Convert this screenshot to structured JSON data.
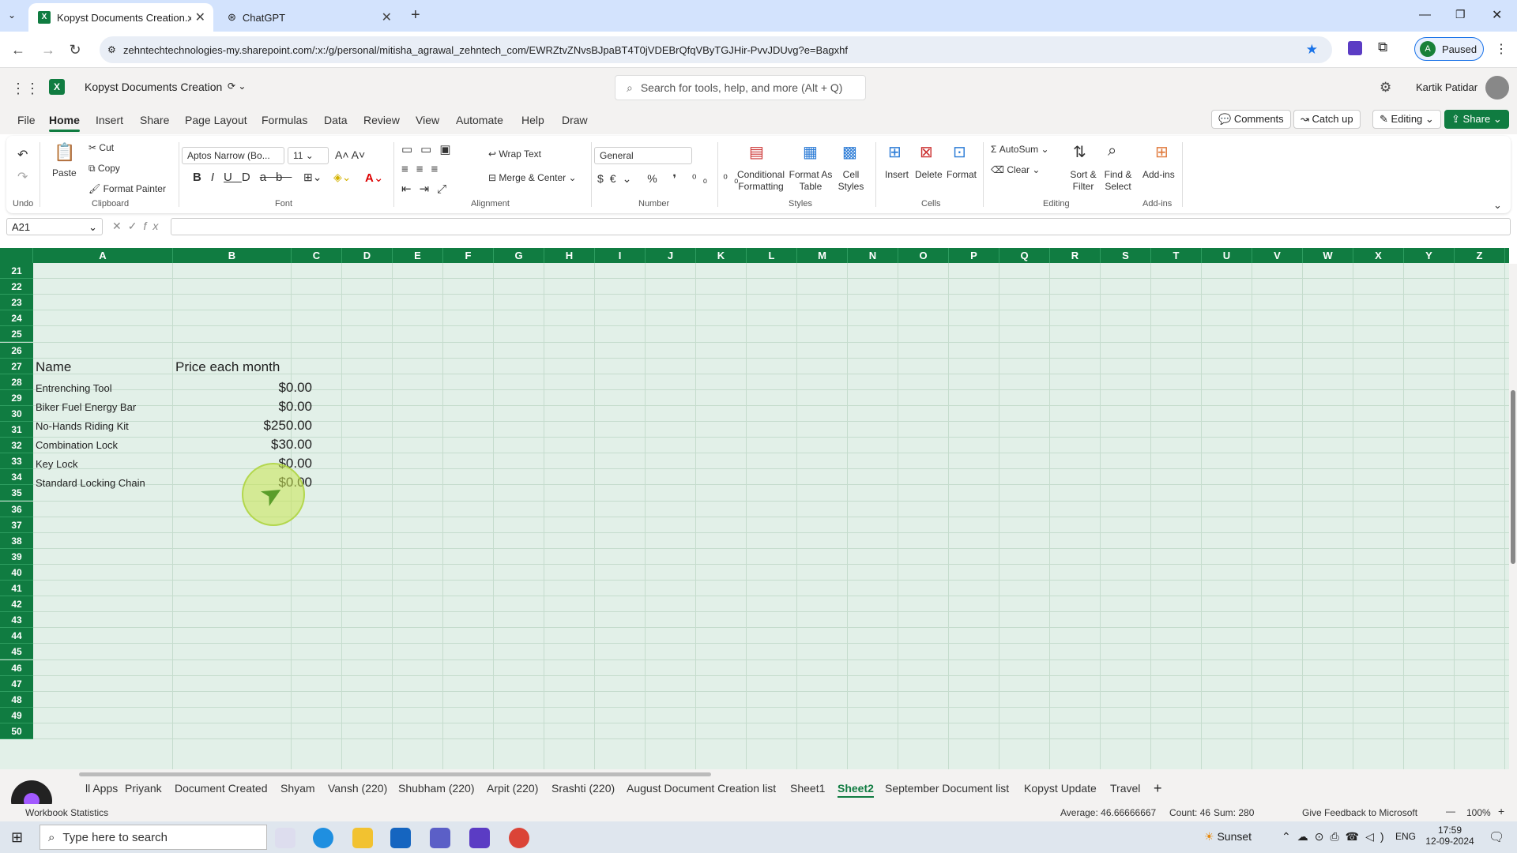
{
  "browser": {
    "tabs": [
      {
        "label": "Kopyst Documents Creation.xls"
      },
      {
        "label": "ChatGPT"
      }
    ],
    "url": "zehntechtechnologies-my.sharepoint.com/:x:/g/personal/mitisha_agrawal_zehntech_com/EWRZtvZNvsBJpaBT4T0jVDEBrQfqVByTGJHir-PvvJDUvg?e=Bagxhf",
    "profile_label": "Paused",
    "profile_initial": "A"
  },
  "excel": {
    "file_name": "Kopyst Documents Creation",
    "search_placeholder": "Search for tools, help, and more (Alt + Q)",
    "user_name": "Kartik Patidar",
    "ribbon_tabs": [
      "File",
      "Home",
      "Insert",
      "Share",
      "Page Layout",
      "Formulas",
      "Data",
      "Review",
      "View",
      "Automate",
      "Help",
      "Draw"
    ],
    "header_buttons": {
      "comments": "Comments",
      "catch_up": "Catch up",
      "editing": "Editing",
      "share": "Share"
    },
    "ribbon": {
      "undo_label": "Undo",
      "paste": "Paste",
      "cut": "Cut",
      "copy": "Copy",
      "format_painter": "Format Painter",
      "clipboard_label": "Clipboard",
      "font_name": "Aptos Narrow (Bo...",
      "font_size": "11",
      "font_label": "Font",
      "wrap_text": "Wrap Text",
      "merge_center": "Merge & Center",
      "alignment_label": "Alignment",
      "number_format": "General",
      "number_label": "Number",
      "conditional_formatting": "Conditional Formatting",
      "format_as_table": "Format As Table",
      "cell_styles": "Cell Styles",
      "styles_label": "Styles",
      "insert": "Insert",
      "delete": "Delete",
      "format": "Format",
      "cells_label": "Cells",
      "autosum": "AutoSum",
      "clear": "Clear",
      "sort_filter": "Sort & Filter",
      "find_select": "Find & Select",
      "editing_label": "Editing",
      "addins": "Add-ins",
      "addins_label": "Add-ins"
    },
    "name_box": "A21",
    "columns": [
      "A",
      "B",
      "C",
      "D",
      "E",
      "F",
      "G",
      "H",
      "I",
      "J",
      "K",
      "L",
      "M",
      "N",
      "O",
      "P",
      "Q",
      "R",
      "S",
      "T",
      "U",
      "V",
      "W",
      "X",
      "Y",
      "Z"
    ],
    "rows": [
      "21",
      "22",
      "23",
      "24",
      "25",
      "26",
      "27",
      "28",
      "29",
      "30",
      "31",
      "32",
      "33",
      "34",
      "35",
      "36",
      "37",
      "38",
      "39",
      "40",
      "41",
      "42",
      "43",
      "44",
      "45",
      "46",
      "47",
      "48",
      "49",
      "50"
    ],
    "table": {
      "header_name": "Name",
      "header_price": "Price each month",
      "items": [
        {
          "name": "Entrenching Tool",
          "price": "$0.00"
        },
        {
          "name": "Biker Fuel Energy Bar",
          "price": "$0.00"
        },
        {
          "name": "No-Hands Riding Kit",
          "price": "$250.00"
        },
        {
          "name": "Combination Lock",
          "price": "$30.00"
        },
        {
          "name": "Key Lock",
          "price": "$0.00"
        },
        {
          "name": "Standard Locking Chain",
          "price": "$0.00"
        }
      ]
    },
    "sheets": [
      "ll Apps",
      "Priyank",
      "Document Created",
      "Shyam",
      "Vansh (220)",
      "Shubham (220)",
      "Arpit (220)",
      "Srashti (220)",
      "August Document Creation list",
      "Sheet1",
      "Sheet2",
      "September Document list",
      "Kopyst Update",
      "Travel"
    ],
    "active_sheet": "Sheet2",
    "status": {
      "workbook_statistics": "Workbook Statistics",
      "average": "Average: 46.66666667",
      "count": "Count: 46",
      "sum": "Sum: 280",
      "feedback": "Give Feedback to Microsoft",
      "zoom": "100%"
    }
  },
  "taskbar": {
    "search_placeholder": "Type here to search",
    "weather": "Sunset",
    "lang": "ENG",
    "time": "17:59",
    "date": "12-09-2024"
  },
  "colors": {
    "excel_green": "#107c41",
    "grid_bg": "#e2f0e8",
    "tab_bar": "#d3e3fd"
  }
}
